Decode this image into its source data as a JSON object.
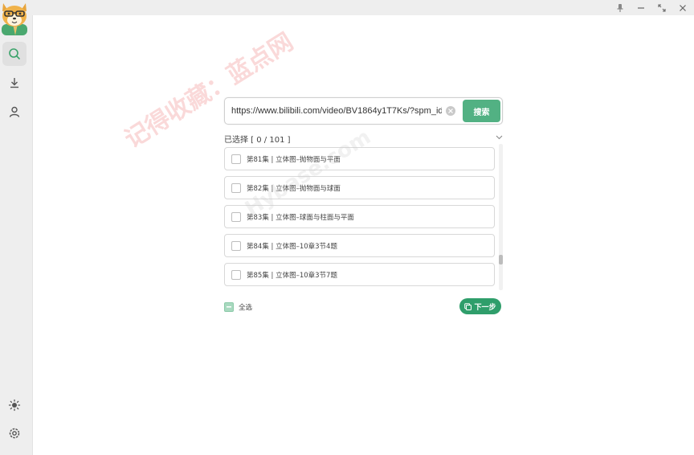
{
  "search": {
    "url_value": "https://www.bilibili.com/video/BV1864y1T7Ks/?spm_id_",
    "button_label": "搜索"
  },
  "selection": {
    "label": "已选择 [ 0 / 101 ]"
  },
  "episodes": [
    {
      "label": "第81集 | 立体图–抛物面与平面"
    },
    {
      "label": "第82集 | 立体图–抛物面与球面"
    },
    {
      "label": "第83集 | 立体图–球面与柱面与平面"
    },
    {
      "label": "第84集 | 立体图–10章3节4题"
    },
    {
      "label": "第85集 | 立体图–10章3节7题"
    }
  ],
  "footer": {
    "select_all_label": "全选",
    "next_label": "下一步"
  },
  "watermark": {
    "text": "记得收藏：蓝点网",
    "text2": "Hybase.com"
  },
  "colors": {
    "accent": "#52b183",
    "accent_dark": "#2f9e6b"
  },
  "icons": {
    "nav": [
      "search-icon",
      "download-icon",
      "user-icon"
    ],
    "bottom": [
      "brightness-icon",
      "settings-icon"
    ],
    "window": [
      "pin-icon",
      "minimize-icon",
      "maximize-icon",
      "close-icon"
    ]
  }
}
